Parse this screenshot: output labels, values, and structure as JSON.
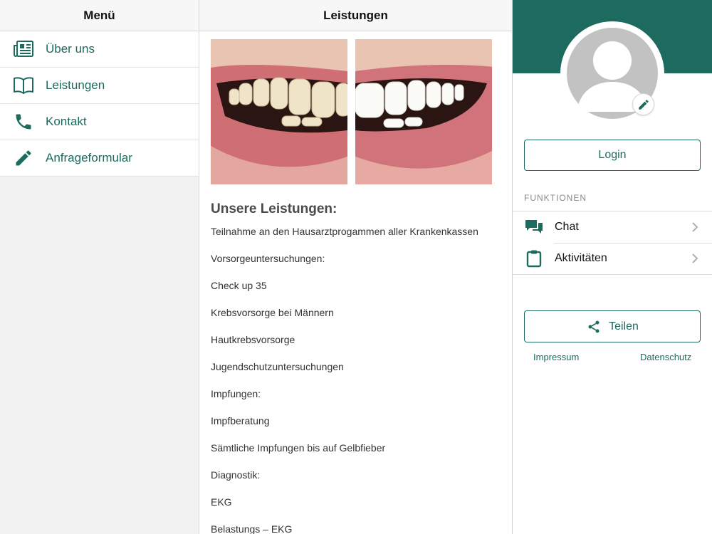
{
  "menu": {
    "title": "Menü",
    "items": [
      {
        "label": "Über uns",
        "icon": "newspaper-icon"
      },
      {
        "label": "Leistungen",
        "icon": "book-icon"
      },
      {
        "label": "Kontakt",
        "icon": "phone-icon"
      },
      {
        "label": "Anfrageformular",
        "icon": "pencil-icon"
      }
    ]
  },
  "content": {
    "title": "Leistungen",
    "image": "teeth-before-after-photo",
    "heading": "Unsere Leistungen:",
    "lines": [
      "Teilnahme an den Hausarztprogammen aller Krankenkassen",
      "Vorsorgeuntersuchungen:",
      "Check up 35",
      "Krebsvorsorge bei Männern",
      "Hautkrebsvorsorge",
      "Jugendschutzuntersuchungen",
      "Impfungen:",
      "Impfberatung",
      "Sämtliche Impfungen bis auf Gelbfieber",
      "Diagnostik:",
      "EKG",
      "Belastungs – EKG"
    ]
  },
  "profile": {
    "avatar": "user-placeholder-avatar",
    "edit_icon": "pencil-icon",
    "login_label": "Login",
    "section_label": "FUNKTIONEN",
    "functions": [
      {
        "label": "Chat",
        "icon": "chat-bubbles-icon"
      },
      {
        "label": "Aktivitäten",
        "icon": "clipboard-icon"
      }
    ],
    "share_label": "Teilen",
    "impressum_label": "Impressum",
    "datenschutz_label": "Datenschutz"
  },
  "colors": {
    "accent": "#1d6b5e",
    "menu_bg": "#f2f2f2",
    "avatar_gray": "#c2c2c2"
  }
}
